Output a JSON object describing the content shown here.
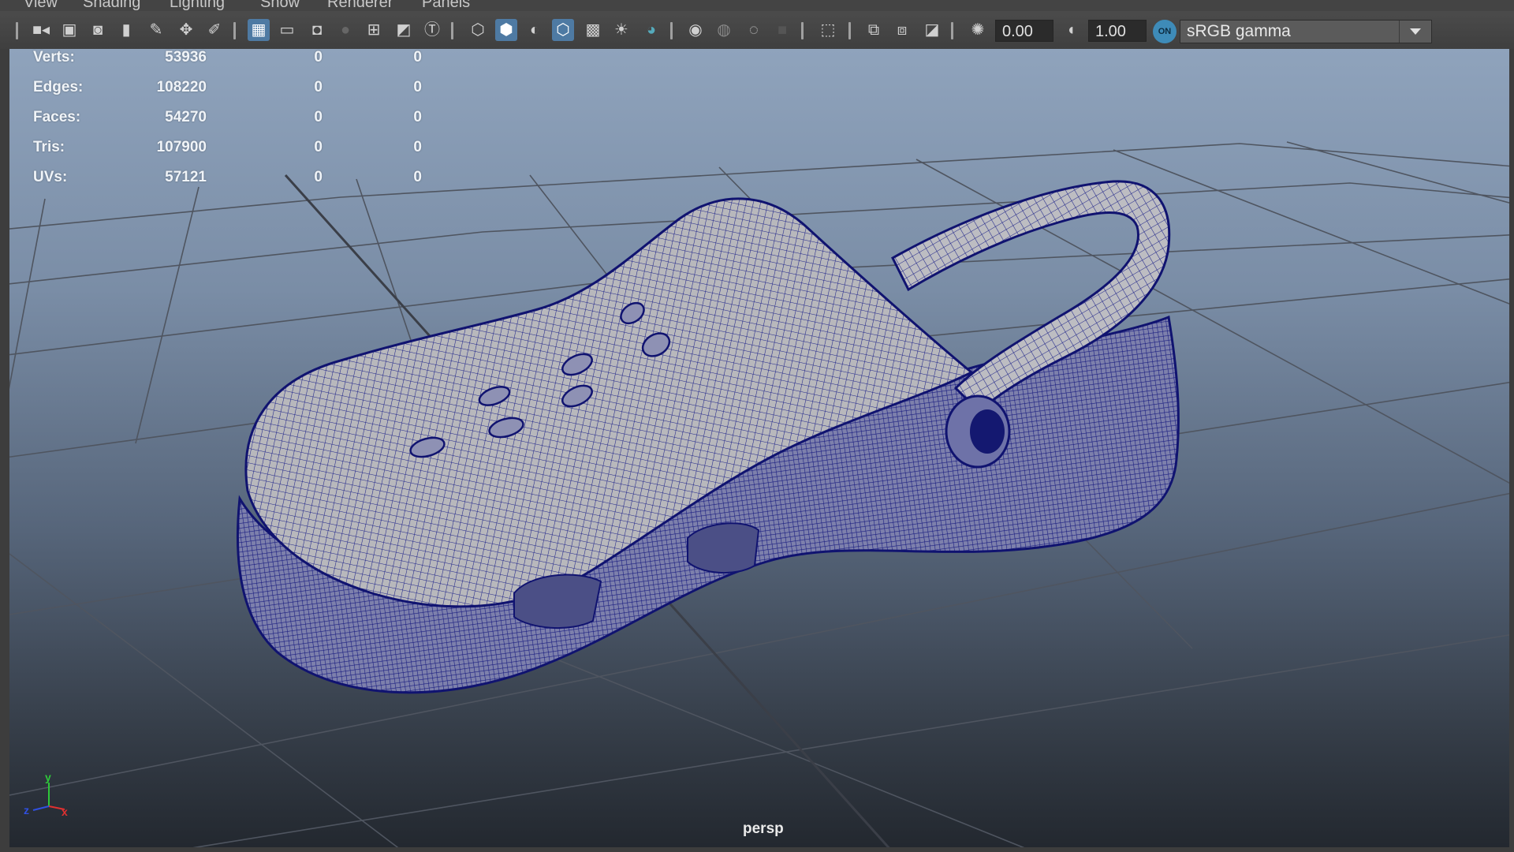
{
  "menu": [
    "View",
    "Shading",
    "Lighting",
    "Show",
    "Renderer",
    "Panels"
  ],
  "toolbar": {
    "icons": [
      "select-camera-icon",
      "camera-attributes-icon",
      "camera-tools-icon",
      "bookmark-icon",
      "image-plane-icon",
      "2d-pan-zoom-icon",
      "grease-pencil-icon",
      "grid-icon",
      "film-gate-icon",
      "resolution-gate-icon",
      "gate-mask-icon",
      "field-chart-icon",
      "safe-action-icon",
      "safe-title-icon",
      "wireframe-icon",
      "smooth-shade-icon",
      "use-default-material-icon",
      "wireframe-on-shaded-icon",
      "xray-icon",
      "use-lights-icon",
      "shadows-icon",
      "screen-space-ambient-occlusion-icon",
      "motion-blur-icon",
      "anti-aliasing-icon",
      "depth-of-field-icon",
      "isolate-select-icon",
      "xray-joints-icon",
      "xray-active-components-icon",
      "backface-culling-icon",
      "exposure-icon",
      "gamma-icon",
      "color-management-icon"
    ],
    "exposure_value": "0.00",
    "gamma_value": "1.00",
    "color_management_badge": "ON",
    "color_space": "sRGB gamma"
  },
  "hud": {
    "rows": [
      {
        "label": "Verts:",
        "object": "53936",
        "selected": "0",
        "components": "0"
      },
      {
        "label": "Edges:",
        "object": "108220",
        "selected": "0",
        "components": "0"
      },
      {
        "label": "Faces:",
        "object": "54270",
        "selected": "0",
        "components": "0"
      },
      {
        "label": "Tris:",
        "object": "107900",
        "selected": "0",
        "components": "0"
      },
      {
        "label": "UVs:",
        "object": "57121",
        "selected": "0",
        "components": "0"
      }
    ]
  },
  "axis_gizmo": {
    "x": "x",
    "y": "y",
    "z": "z"
  },
  "camera_label": "persp",
  "colors": {
    "wire": "#1a1f8a",
    "mesh_fill": "#b4b4b8",
    "active_icon": "#4e7aa3",
    "grid_line": "#50545c"
  }
}
